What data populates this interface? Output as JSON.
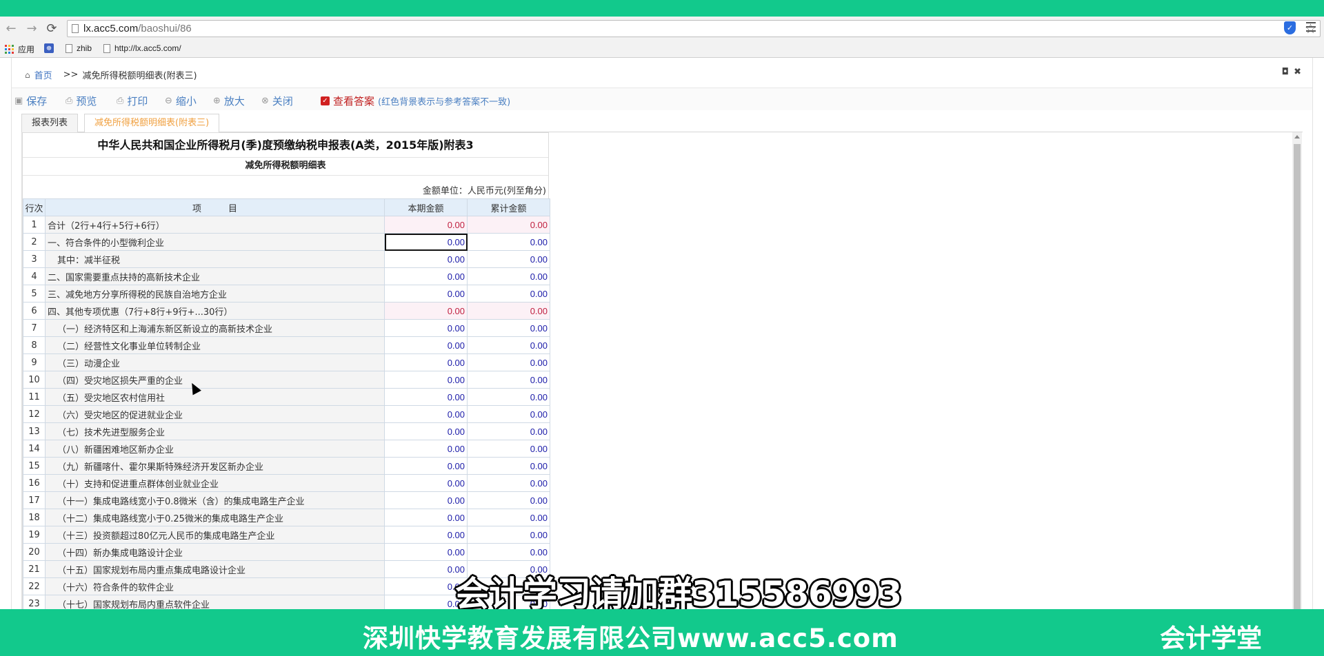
{
  "browser": {
    "url_host": "lx.acc5.com",
    "url_path": "/baoshui/86",
    "bookmarks": [
      "应用",
      "zhib",
      "http://lx.acc5.com/"
    ]
  },
  "breadcrumb": {
    "home": "首页",
    "separator": ">>",
    "current": "减免所得税额明细表(附表三)"
  },
  "window_controls": {
    "restore": "◘",
    "close": "✖"
  },
  "toolbar": {
    "save": "保存",
    "preview": "预览",
    "print": "打印",
    "zoom_out": "缩小",
    "zoom_in": "放大",
    "close": "关闭",
    "answer": "查看答案",
    "answer_note": "(红色背景表示与参考答案不一致)"
  },
  "tabs": [
    "报表列表",
    "减免所得税额明细表(附表三)"
  ],
  "report": {
    "title": "中华人民共和国企业所得税月(季)度预缴纳税申报表(A类，2015年版)附表3",
    "subtitle": "减免所得税额明细表",
    "unit": "金额单位：人民币元(列至角分)",
    "headers": {
      "no": "行次",
      "item": "项　　　目",
      "current": "本期金额",
      "cumulative": "累计金额"
    },
    "rows": [
      {
        "no": "1",
        "item": "合计（2行+4行+5行+6行）",
        "current": "0.00",
        "cumulative": "0.00",
        "calc": true,
        "indent": false
      },
      {
        "no": "2",
        "item": "一、符合条件的小型微利企业",
        "current": "0.00",
        "cumulative": "0.00",
        "calc": false,
        "indent": false,
        "focus": true
      },
      {
        "no": "3",
        "item": "其中：减半征税",
        "current": "0.00",
        "cumulative": "0.00",
        "calc": false,
        "indent": true
      },
      {
        "no": "4",
        "item": "二、国家需要重点扶持的高新技术企业",
        "current": "0.00",
        "cumulative": "0.00",
        "calc": false,
        "indent": false
      },
      {
        "no": "5",
        "item": "三、减免地方分享所得税的民族自治地方企业",
        "current": "0.00",
        "cumulative": "0.00",
        "calc": false,
        "indent": false
      },
      {
        "no": "6",
        "item": "四、其他专项优惠（7行+8行+9行+...30行）",
        "current": "0.00",
        "cumulative": "0.00",
        "calc": true,
        "indent": false
      },
      {
        "no": "7",
        "item": "（一）经济特区和上海浦东新区新设立的高新技术企业",
        "current": "0.00",
        "cumulative": "0.00",
        "calc": false,
        "indent": true
      },
      {
        "no": "8",
        "item": "（二）经营性文化事业单位转制企业",
        "current": "0.00",
        "cumulative": "0.00",
        "calc": false,
        "indent": true
      },
      {
        "no": "9",
        "item": "（三）动漫企业",
        "current": "0.00",
        "cumulative": "0.00",
        "calc": false,
        "indent": true
      },
      {
        "no": "10",
        "item": "（四）受灾地区损失严重的企业",
        "current": "0.00",
        "cumulative": "0.00",
        "calc": false,
        "indent": true
      },
      {
        "no": "11",
        "item": "（五）受灾地区农村信用社",
        "current": "0.00",
        "cumulative": "0.00",
        "calc": false,
        "indent": true
      },
      {
        "no": "12",
        "item": "（六）受灾地区的促进就业企业",
        "current": "0.00",
        "cumulative": "0.00",
        "calc": false,
        "indent": true
      },
      {
        "no": "13",
        "item": "（七）技术先进型服务企业",
        "current": "0.00",
        "cumulative": "0.00",
        "calc": false,
        "indent": true
      },
      {
        "no": "14",
        "item": "（八）新疆困难地区新办企业",
        "current": "0.00",
        "cumulative": "0.00",
        "calc": false,
        "indent": true
      },
      {
        "no": "15",
        "item": "（九）新疆喀什、霍尔果斯特殊经济开发区新办企业",
        "current": "0.00",
        "cumulative": "0.00",
        "calc": false,
        "indent": true
      },
      {
        "no": "16",
        "item": "（十）支持和促进重点群体创业就业企业",
        "current": "0.00",
        "cumulative": "0.00",
        "calc": false,
        "indent": true
      },
      {
        "no": "17",
        "item": "（十一）集成电路线宽小于0.8微米（含）的集成电路生产企业",
        "current": "0.00",
        "cumulative": "0.00",
        "calc": false,
        "indent": true
      },
      {
        "no": "18",
        "item": "（十二）集成电路线宽小于0.25微米的集成电路生产企业",
        "current": "0.00",
        "cumulative": "0.00",
        "calc": false,
        "indent": true
      },
      {
        "no": "19",
        "item": "（十三）投资额超过80亿元人民币的集成电路生产企业",
        "current": "0.00",
        "cumulative": "0.00",
        "calc": false,
        "indent": true
      },
      {
        "no": "20",
        "item": "（十四）新办集成电路设计企业",
        "current": "0.00",
        "cumulative": "0.00",
        "calc": false,
        "indent": true
      },
      {
        "no": "21",
        "item": "（十五）国家规划布局内重点集成电路设计企业",
        "current": "0.00",
        "cumulative": "0.00",
        "calc": false,
        "indent": true
      },
      {
        "no": "22",
        "item": "（十六）符合条件的软件企业",
        "current": "0.00",
        "cumulative": "0.00",
        "calc": false,
        "indent": true
      },
      {
        "no": "23",
        "item": "（十七）国家规划布局内重点软件企业",
        "current": "0.00",
        "cumulative": "0.00",
        "calc": false,
        "indent": true
      }
    ]
  },
  "overlay": {
    "caption": "会计学习请加群315586993",
    "company": "深圳快学教育发展有限公司www.acc5.com",
    "brand": "会计学堂"
  },
  "colors": {
    "brand_green": "#12c98c",
    "link_blue": "#4a7fc1",
    "value_blue": "#1a1aa8",
    "calc_red": "#c02040",
    "active_tab": "#f0a040"
  }
}
